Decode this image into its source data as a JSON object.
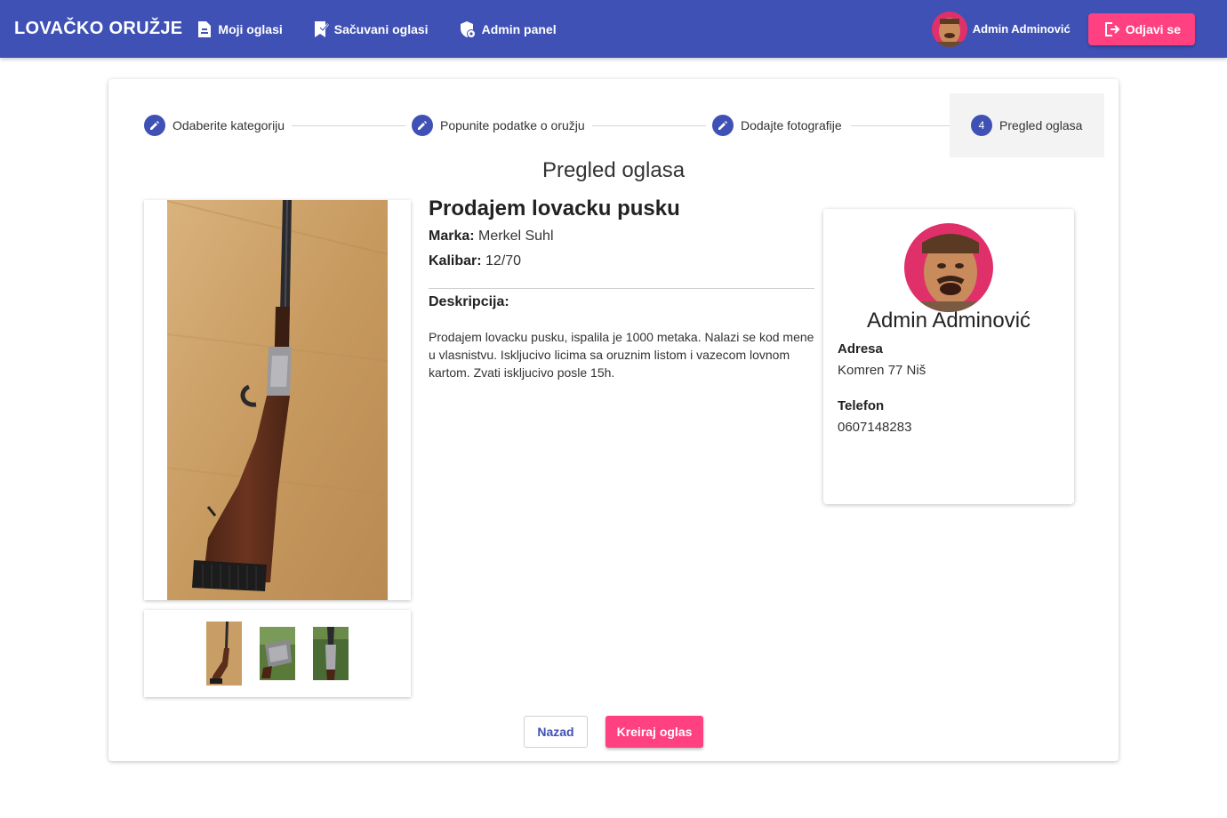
{
  "topbar": {
    "brand": "LOVAČKO ORUŽJE",
    "nav": [
      {
        "label": "Moji oglasi",
        "icon": "document-icon"
      },
      {
        "label": "Sačuvani oglasi",
        "icon": "bookmark-check-icon"
      },
      {
        "label": "Admin panel",
        "icon": "shield-gear-icon"
      }
    ],
    "user_name": "Admin Adminović",
    "logout_label": "Odjavi se"
  },
  "stepper": {
    "steps": [
      {
        "label": "Odaberite kategoriju",
        "state": "edit"
      },
      {
        "label": "Popunite podatke o oružju",
        "state": "edit"
      },
      {
        "label": "Dodajte fotografije",
        "state": "edit"
      },
      {
        "label": "Pregled oglasa",
        "number": "4",
        "state": "active"
      }
    ]
  },
  "review": {
    "heading": "Pregled oglasa",
    "ad_title": "Prodajem lovacku pusku",
    "brand_label": "Marka:",
    "brand_value": "Merkel Suhl",
    "caliber_label": "Kalibar:",
    "caliber_value": "12/70",
    "description_label": "Deskripcija:",
    "description": "Prodajem lovacku pusku, ispalila je 1000 metaka. Nalazi se kod mene u vlasnistvu. Iskljucivo licima sa oruznim listom i vazecom lovnom kartom. Zvati iskljucivo posle 15h."
  },
  "seller": {
    "name": "Admin Adminović",
    "address_label": "Adresa",
    "address": "Komren 77 Niš",
    "phone_label": "Telefon",
    "phone": "0607148283"
  },
  "actions": {
    "back_label": "Nazad",
    "create_label": "Kreiraj oglas"
  },
  "colors": {
    "primary": "#3f51b5",
    "accent": "#ff4081"
  }
}
